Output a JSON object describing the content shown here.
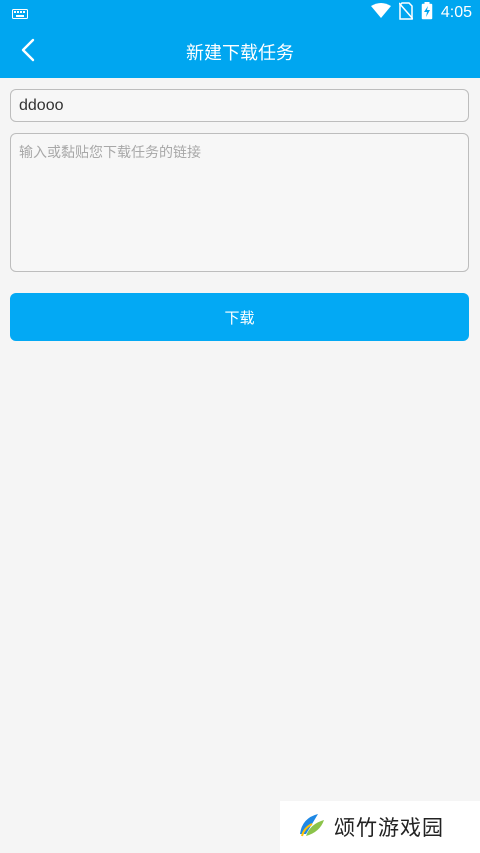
{
  "status_bar": {
    "time": "4:05",
    "icons": [
      "keyboard-icon",
      "wifi-icon",
      "no-sim-icon",
      "battery-charging-icon"
    ]
  },
  "app_bar": {
    "title": "新建下载任务",
    "back_icon": "chevron-left-icon"
  },
  "form": {
    "name_value": "ddooo",
    "url_value": "",
    "url_placeholder": "输入或黏贴您下载任务的链接",
    "download_label": "下载"
  },
  "watermark": {
    "text": "颂竹游戏园",
    "icon": "leaf-logo-icon"
  },
  "colors": {
    "accent": "#00a6f0",
    "button": "#03a9f4",
    "background": "#f5f5f5",
    "border": "#bdbdbd"
  }
}
